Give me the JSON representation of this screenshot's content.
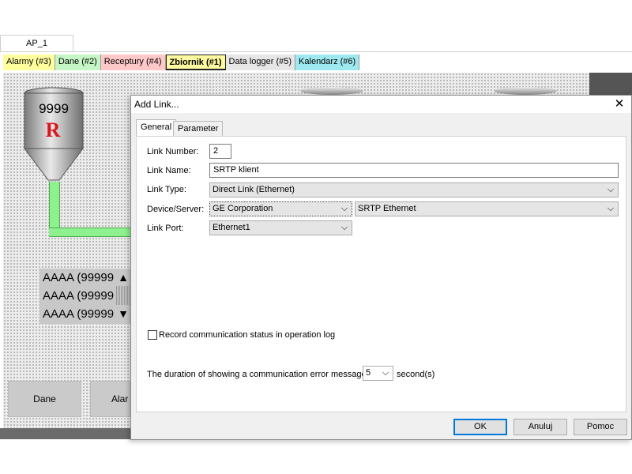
{
  "document_tab": "AP_1",
  "screen_tabs": [
    {
      "label": "Alarmy (#3)",
      "color": "#ffff9e"
    },
    {
      "label": "Dane (#2)",
      "color": "#c6f5c6"
    },
    {
      "label": "Receptury (#4)",
      "color": "#ffc8c8"
    },
    {
      "label": "Zbiornik (#1)",
      "color": "#fffaa0"
    },
    {
      "label": "Data logger (#5)",
      "color": "#e6e6e6"
    },
    {
      "label": "Kalendarz (#6)",
      "color": "#9ee8f0"
    }
  ],
  "canvas": {
    "tank_value": "9999",
    "tank_logo": "R",
    "list_rows": [
      "AAAA (99999",
      "AAAA (99999",
      "AAAA (99999"
    ],
    "buttons": [
      "Dane",
      "Alar"
    ]
  },
  "dialog": {
    "title": "Add Link...",
    "tabs": [
      "General",
      "Parameter"
    ],
    "fields": {
      "link_number_label": "Link Number:",
      "link_number_value": "2",
      "link_name_label": "Link Name:",
      "link_name_value": "SRTP klient",
      "link_type_label": "Link Type:",
      "link_type_value": "Direct Link (Ethernet)",
      "device_server_label": "Device/Server:",
      "device_value": "GE Corporation",
      "server_value": "SRTP Ethernet",
      "link_port_label": "Link Port:",
      "link_port_value": "Ethernet1"
    },
    "record_status_label": "Record communication status in operation log",
    "duration_label": "The duration of showing a communication error message:",
    "duration_value": "5",
    "duration_unit": "second(s)",
    "buttons": {
      "ok": "OK",
      "cancel": "Anuluj",
      "help": "Pomoc"
    }
  }
}
